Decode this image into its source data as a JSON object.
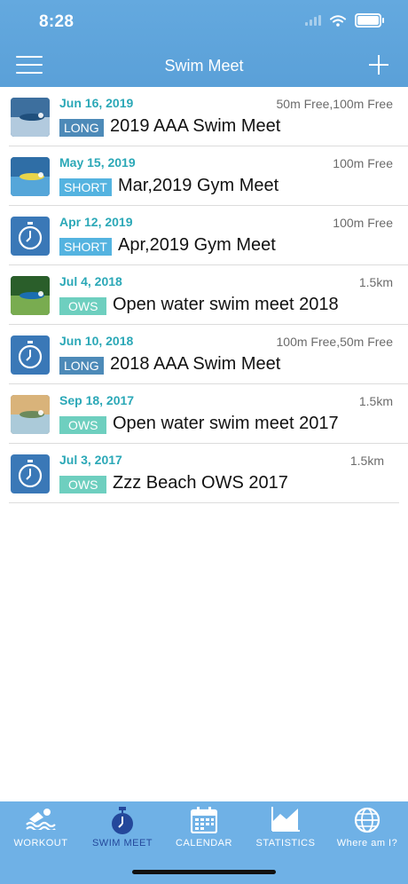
{
  "status": {
    "time": "8:28"
  },
  "nav": {
    "title": "Swim Meet"
  },
  "meets": [
    {
      "date": "Jun 16, 2019",
      "events": "50m Free,100m Free",
      "course": "LONG",
      "name": "2019 AAA Swim Meet",
      "thumb": "photo"
    },
    {
      "date": "May 15, 2019",
      "events": "100m Free",
      "course": "SHORT",
      "name": "Mar,2019 Gym Meet",
      "thumb": "photo"
    },
    {
      "date": "Apr 12, 2019",
      "events": "100m Free",
      "course": "SHORT",
      "name": "Apr,2019 Gym Meet",
      "thumb": "timer"
    },
    {
      "date": "Jul 4, 2018",
      "events": "1.5km",
      "course": "OWS",
      "name": "Open water swim meet 2018",
      "thumb": "photo"
    },
    {
      "date": "Jun 10, 2018",
      "events": "100m Free,50m Free",
      "course": "LONG",
      "name": "2018 AAA Swim Meet",
      "thumb": "timer"
    },
    {
      "date": "Sep 18, 2017",
      "events": "1.5km",
      "course": "OWS",
      "name": "Open water swim meet 2017",
      "thumb": "photo"
    },
    {
      "date": "Jul 3, 2017",
      "events": "1.5km",
      "course": "OWS",
      "name": "Zzz Beach OWS 2017",
      "thumb": "timer"
    }
  ],
  "tabs": [
    {
      "label": "WORKOUT",
      "icon": "swimmer-icon"
    },
    {
      "label": "SWIM MEET",
      "icon": "stopwatch-icon",
      "active": true
    },
    {
      "label": "CALENDAR",
      "icon": "calendar-icon"
    },
    {
      "label": "STATISTICS",
      "icon": "chart-icon"
    },
    {
      "label": "Where am I?",
      "icon": "globe-icon"
    }
  ],
  "colors": {
    "header": "#5aa0d8",
    "date": "#2ba8b7",
    "long_badge": "#4d8ab8",
    "short_badge": "#54b3e0",
    "ows_badge": "#6ecfbf",
    "tabbar": "#6fb1e6",
    "active_tab": "#24489b"
  }
}
